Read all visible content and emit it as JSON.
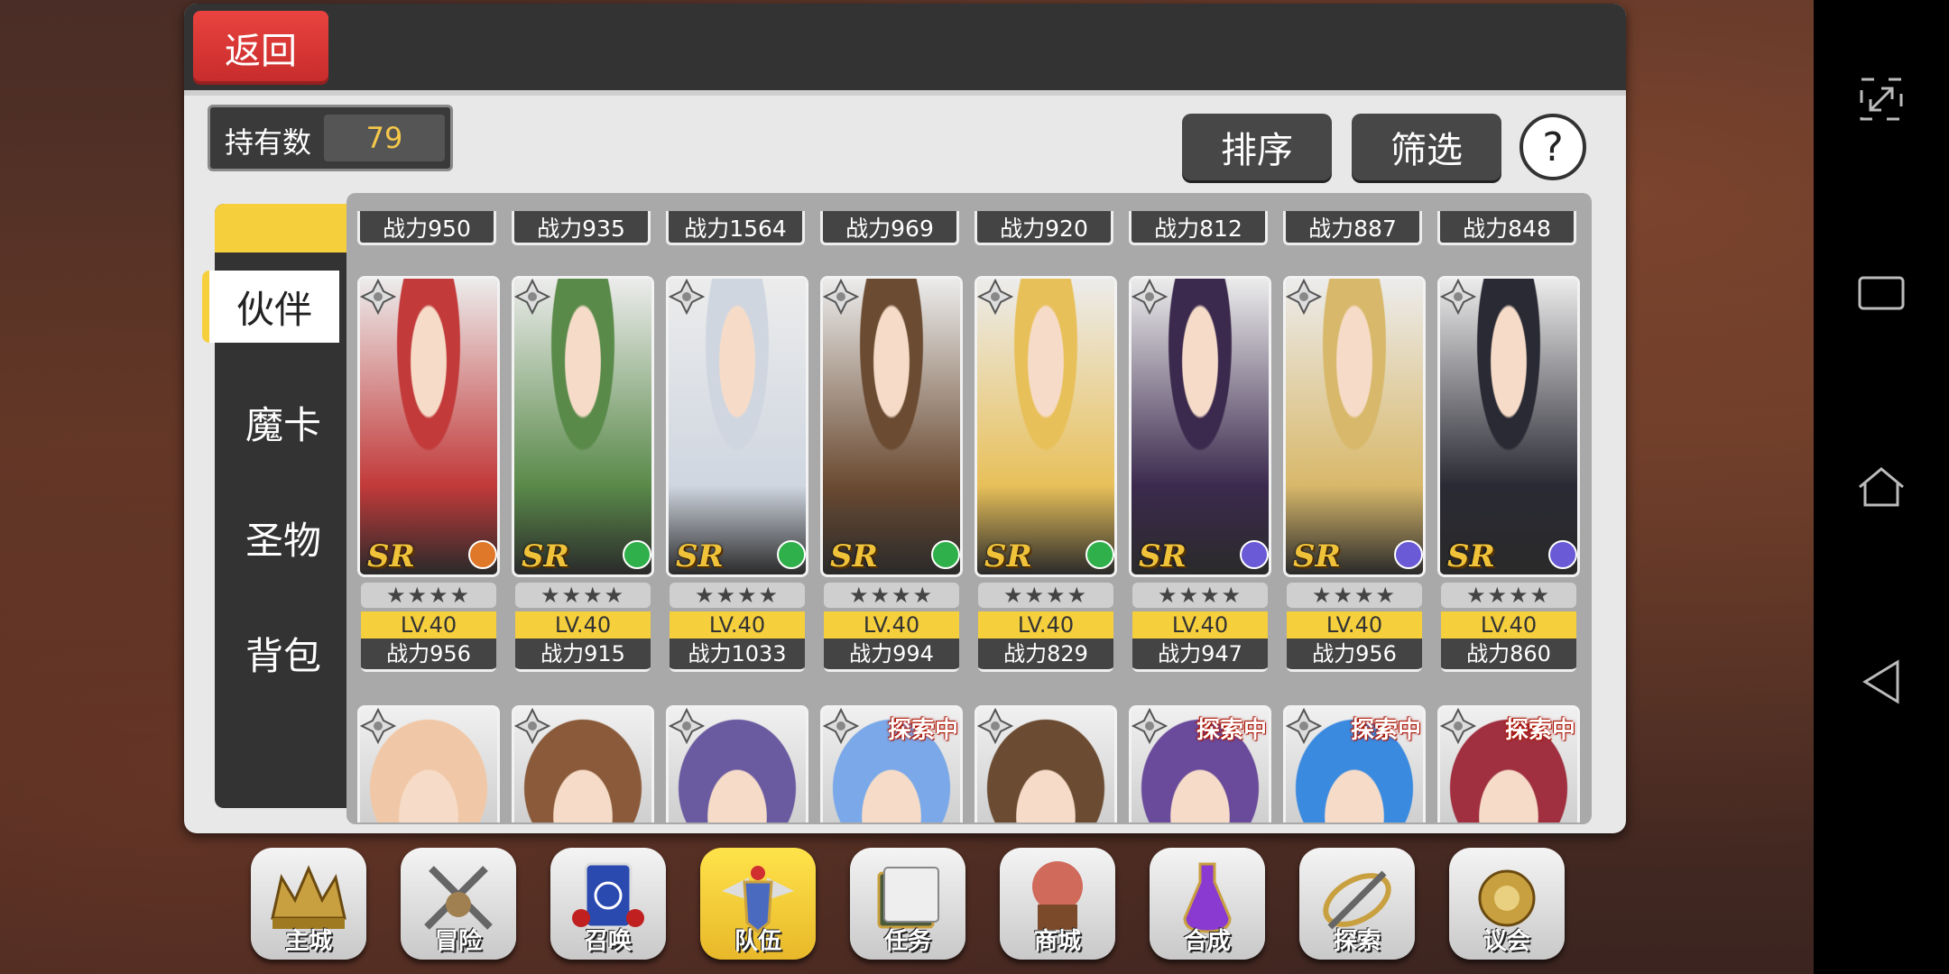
{
  "header": {
    "back_label": "返回"
  },
  "owned": {
    "label": "持有数",
    "count": "79"
  },
  "toolbar": {
    "sort_label": "排序",
    "filter_label": "筛选",
    "help_label": "?"
  },
  "tabs": [
    {
      "label": "伙伴",
      "active": true
    },
    {
      "label": "魔卡",
      "active": false
    },
    {
      "label": "圣物",
      "active": false
    },
    {
      "label": "背包",
      "active": false
    }
  ],
  "top_row_power": [
    "战力950",
    "战力935",
    "战力1564",
    "战力969",
    "战力920",
    "战力812",
    "战力887",
    "战力848"
  ],
  "cards": [
    {
      "rarity": "SR",
      "stars": "★★★★",
      "level": "LV.40",
      "power": "战力956",
      "class_icon": "orange-class-icon",
      "accent": "#c23a3a"
    },
    {
      "rarity": "SR",
      "stars": "★★★★",
      "level": "LV.40",
      "power": "战力915",
      "class_icon": "green-class-icon",
      "accent": "#5a8a4a"
    },
    {
      "rarity": "SR",
      "stars": "★★★★",
      "level": "LV.40",
      "power": "战力1033",
      "class_icon": "green-class-icon",
      "accent": "#cfd6e0"
    },
    {
      "rarity": "SR",
      "stars": "★★★★",
      "level": "LV.40",
      "power": "战力994",
      "class_icon": "green-class-icon",
      "accent": "#6b4b32"
    },
    {
      "rarity": "SR",
      "stars": "★★★★",
      "level": "LV.40",
      "power": "战力829",
      "class_icon": "green-class-icon",
      "accent": "#e8c05a"
    },
    {
      "rarity": "SR",
      "stars": "★★★★",
      "level": "LV.40",
      "power": "战力947",
      "class_icon": "purple-class-icon",
      "accent": "#3c2a4e"
    },
    {
      "rarity": "SR",
      "stars": "★★★★",
      "level": "LV.40",
      "power": "战力956",
      "class_icon": "purple-class-icon",
      "accent": "#d8b86a"
    },
    {
      "rarity": "SR",
      "stars": "★★★★",
      "level": "LV.40",
      "power": "战力860",
      "class_icon": "purple-class-icon",
      "accent": "#2a2a34"
    }
  ],
  "bottom_row": [
    {
      "tag": "",
      "accent": "#f0c8a8"
    },
    {
      "tag": "",
      "accent": "#8a5a3a"
    },
    {
      "tag": "",
      "accent": "#6a5aa0"
    },
    {
      "tag": "探索中",
      "accent": "#7aa8e8"
    },
    {
      "tag": "",
      "accent": "#6b4b32"
    },
    {
      "tag": "探索中",
      "accent": "#6a4a9a"
    },
    {
      "tag": "探索中",
      "accent": "#3a8ae0"
    },
    {
      "tag": "探索中",
      "accent": "#a03040"
    }
  ],
  "menu": [
    {
      "label": "主城",
      "icon": "crown-icon",
      "active": false
    },
    {
      "label": "冒险",
      "icon": "swords-icon",
      "active": false
    },
    {
      "label": "召唤",
      "icon": "summon-card-icon",
      "active": false
    },
    {
      "label": "队伍",
      "icon": "team-emblem-icon",
      "active": true
    },
    {
      "label": "任务",
      "icon": "quest-book-icon",
      "active": false
    },
    {
      "label": "商城",
      "icon": "shop-icon",
      "active": false
    },
    {
      "label": "合成",
      "icon": "potion-icon",
      "active": false
    },
    {
      "label": "探索",
      "icon": "explore-icon",
      "active": false
    },
    {
      "label": "议会",
      "icon": "council-icon",
      "active": false
    }
  ]
}
